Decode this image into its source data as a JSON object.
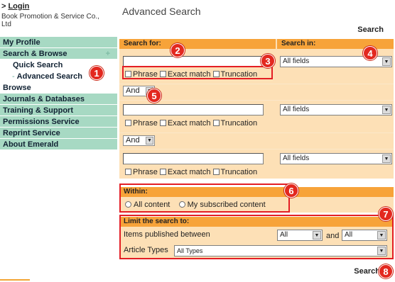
{
  "header": {
    "login_prefix": ">",
    "login_link": "Login",
    "organization": "Book Promotion & Service Co., Ltd",
    "page_title": "Advanced Search",
    "search_top": "Search",
    "search_bottom": "Search"
  },
  "sidebar": {
    "items": [
      {
        "label": "My Profile"
      },
      {
        "label": "Search & Browse",
        "expand_glyph": "+"
      },
      {
        "label": "Quick Search"
      },
      {
        "label": "Advanced Search",
        "dash": "-"
      },
      {
        "label": "Browse"
      },
      {
        "label": "Journals & Databases"
      },
      {
        "label": "Training & Support"
      },
      {
        "label": "Permissions Service"
      },
      {
        "label": "Reprint Service"
      },
      {
        "label": "About Emerald"
      }
    ]
  },
  "search_panel": {
    "search_for_header": "Search for:",
    "search_in_header": "Search in:",
    "rows": [
      {
        "query": "",
        "search_in": "All fields",
        "options": [
          "Phrase",
          "Exact match",
          "Truncation"
        ]
      },
      {
        "query": "",
        "search_in": "All fields",
        "options": [
          "Phrase",
          "Exact match",
          "Truncation"
        ]
      },
      {
        "query": "",
        "search_in": "All fields",
        "options": [
          "Phrase",
          "Exact match",
          "Truncation"
        ]
      }
    ],
    "booleans": [
      "And",
      "And"
    ]
  },
  "within": {
    "header": "Within:",
    "options": [
      "All content",
      "My subscribed content"
    ]
  },
  "limit": {
    "header": "Limit the search to:",
    "published_label": "Items published between",
    "from_value": "All",
    "and_text": "and",
    "to_value": "All",
    "article_types_label": "Article Types",
    "article_types_value": "All Types"
  },
  "annotations": [
    "1",
    "2",
    "3",
    "4",
    "5",
    "6",
    "7",
    "8"
  ],
  "colors": {
    "accent_orange": "#f7a339",
    "panel_bg": "#fde0b6",
    "nav_green": "#a7d9c3",
    "annotation_red": "#e31e24"
  }
}
